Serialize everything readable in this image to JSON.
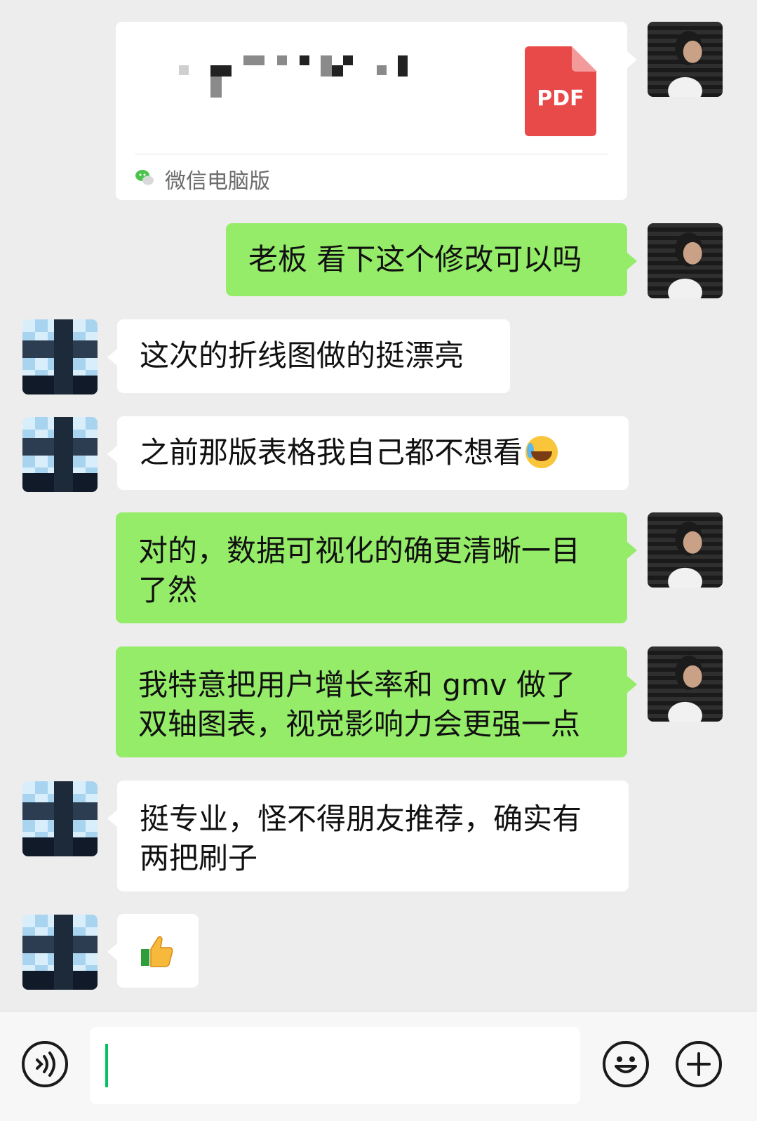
{
  "file_message": {
    "file_type_label": "PDF",
    "source_label": "微信电脑版"
  },
  "messages": [
    {
      "side": "me",
      "text": "老板 看下这个修改可以吗"
    },
    {
      "side": "other",
      "text": "这次的折线图做的挺漂亮"
    },
    {
      "side": "other",
      "text": "之前那版表格我自己都不想看"
    },
    {
      "side": "me",
      "text_line1": "对的，数据可视化的确更清晰一目",
      "text_line2": "了然"
    },
    {
      "side": "me",
      "text_line1": "我特意把用户增长率和 gmv 做了",
      "text_line2": "双轴图表，视觉影响力会更强一点"
    },
    {
      "side": "other",
      "text_line1": "挺专业，怪不得朋友推荐，确实有",
      "text_line2": "两把刷子"
    },
    {
      "side": "other",
      "emoji": "thumbs-up"
    }
  ],
  "emojis": {
    "laughing_crying": "loudly-crying-face",
    "thumbs_up": "thumbs-up"
  },
  "input_bar": {
    "value": ""
  },
  "colors": {
    "my_bubble": "#95ec69",
    "other_bubble": "#ffffff",
    "background": "#ededed",
    "pdf": "#e84a4a",
    "cursor": "#07c160"
  }
}
